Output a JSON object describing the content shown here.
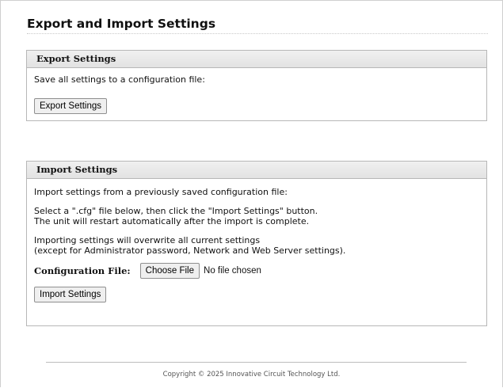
{
  "page": {
    "title": "Export and Import Settings"
  },
  "export_panel": {
    "header": "Export Settings",
    "description": "Save all settings to a configuration file:",
    "button_label": "Export Settings"
  },
  "import_panel": {
    "header": "Import Settings",
    "intro": "Import settings from a previously saved configuration file:",
    "instructions_line1": "Select a \".cfg\" file below, then click the \"Import Settings\" button.",
    "instructions_line2": "The unit will restart automatically after the import is complete.",
    "warning_line1": "Importing settings will overwrite all current settings",
    "warning_line2": "(except for Administrator password, Network and Web Server settings).",
    "file_label": "Configuration File:",
    "choose_file_label": "Choose File",
    "no_file_text": "No file chosen",
    "button_label": "Import Settings"
  },
  "footer": {
    "copyright": "Copyright © 2025 Innovative Circuit Technology Ltd."
  }
}
